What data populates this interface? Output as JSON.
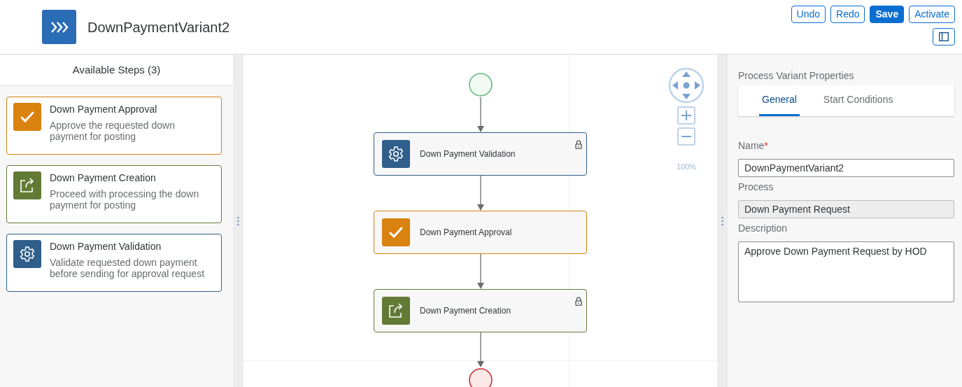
{
  "header": {
    "title": "DownPaymentVariant2",
    "buttons": [
      {
        "label": "Undo",
        "kind": "outline"
      },
      {
        "label": "Redo",
        "kind": "outline"
      },
      {
        "label": "Save",
        "kind": "primary"
      },
      {
        "label": "Activate",
        "kind": "outline"
      }
    ]
  },
  "steps_panel": {
    "title": "Available Steps (3)",
    "steps": [
      {
        "kind": "approval",
        "color": "#d9820f",
        "title": "Down Payment Approval",
        "description": "Approve the requested down payment for posting"
      },
      {
        "kind": "creation",
        "color": "#637a35",
        "title": "Down Payment Creation",
        "description": "Proceed with processing the down payment for posting"
      },
      {
        "kind": "validation",
        "color": "#2f5f8a",
        "title": "Down Payment Validation",
        "description": "Validate requested down payment before sending for approval request"
      }
    ]
  },
  "canvas": {
    "zoom": "100%",
    "nodes": [
      {
        "kind": "validation",
        "color": "#2f5f8a",
        "label": "Down Payment Validation",
        "locked": true
      },
      {
        "kind": "approval",
        "color": "#d9820f",
        "label": "Down Payment Approval",
        "locked": false
      },
      {
        "kind": "creation",
        "color": "#637a35",
        "label": "Down Payment Creation",
        "locked": true
      }
    ]
  },
  "properties": {
    "title": "Process Variant Properties",
    "tabs": [
      {
        "label": "General",
        "selected": true
      },
      {
        "label": "Start Conditions",
        "selected": false
      }
    ],
    "fields": [
      {
        "label": "Name",
        "required_mark": "*",
        "value": "DownPaymentVariant2",
        "kind": "input",
        "disabled": false
      },
      {
        "label": "Process",
        "value": "Down Payment Request",
        "kind": "input",
        "disabled": true
      },
      {
        "label": "Description",
        "value": "Approve Down Payment Request by HOD",
        "kind": "textarea",
        "disabled": false
      }
    ]
  }
}
